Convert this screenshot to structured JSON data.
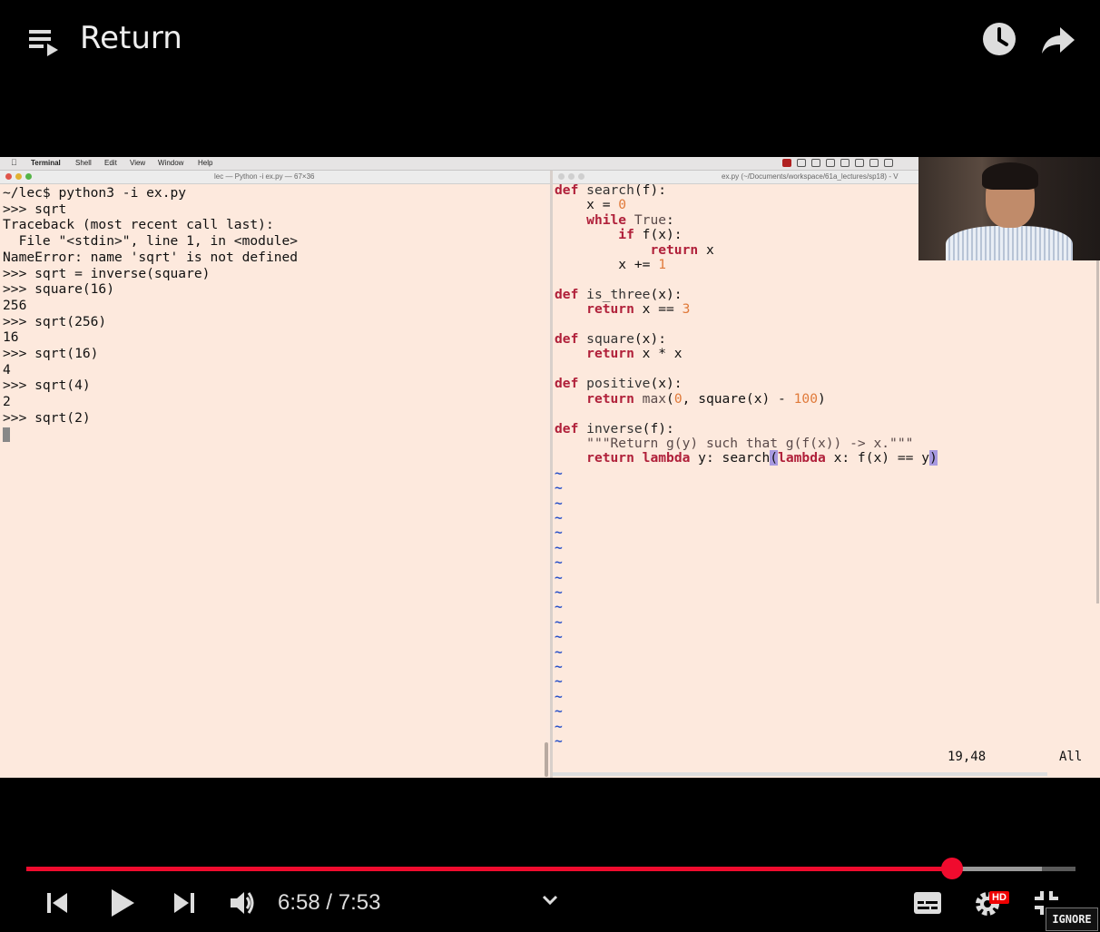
{
  "video": {
    "title": "Return",
    "current_time": "6:58",
    "duration": "7:53",
    "time_separator": " / ",
    "progress": 0.882,
    "buffered": 0.968,
    "quality_badge": "HD",
    "ignore_label": "IGNORE"
  },
  "mac_menu": {
    "items": [
      "Terminal",
      "Shell",
      "Edit",
      "View",
      "Window",
      "Help"
    ]
  },
  "terminal": {
    "window_title": "lec — Python -i ex.py — 67×36",
    "lines": [
      "~/lec$ python3 -i ex.py",
      ">>> sqrt",
      "Traceback (most recent call last):",
      "  File \"<stdin>\", line 1, in <module>",
      "NameError: name 'sqrt' is not defined",
      ">>> sqrt = inverse(square)",
      ">>> square(16)",
      "256",
      ">>> sqrt(256)",
      "16",
      ">>> sqrt(16)",
      "4",
      ">>> sqrt(4)",
      "2",
      ">>> sqrt(2)"
    ]
  },
  "editor": {
    "window_title": "ex.py (~/Documents/workspace/61a_lectures/sp18) - V",
    "cursor_position": "19,48",
    "scroll_position": "All",
    "tilde_count": 19
  },
  "colors": {
    "accent": "#f00b2e",
    "terminal_bg": "#fde9dd",
    "keyword": "#b0203a",
    "number": "#e07a3a",
    "tilde": "#2a52c8"
  }
}
